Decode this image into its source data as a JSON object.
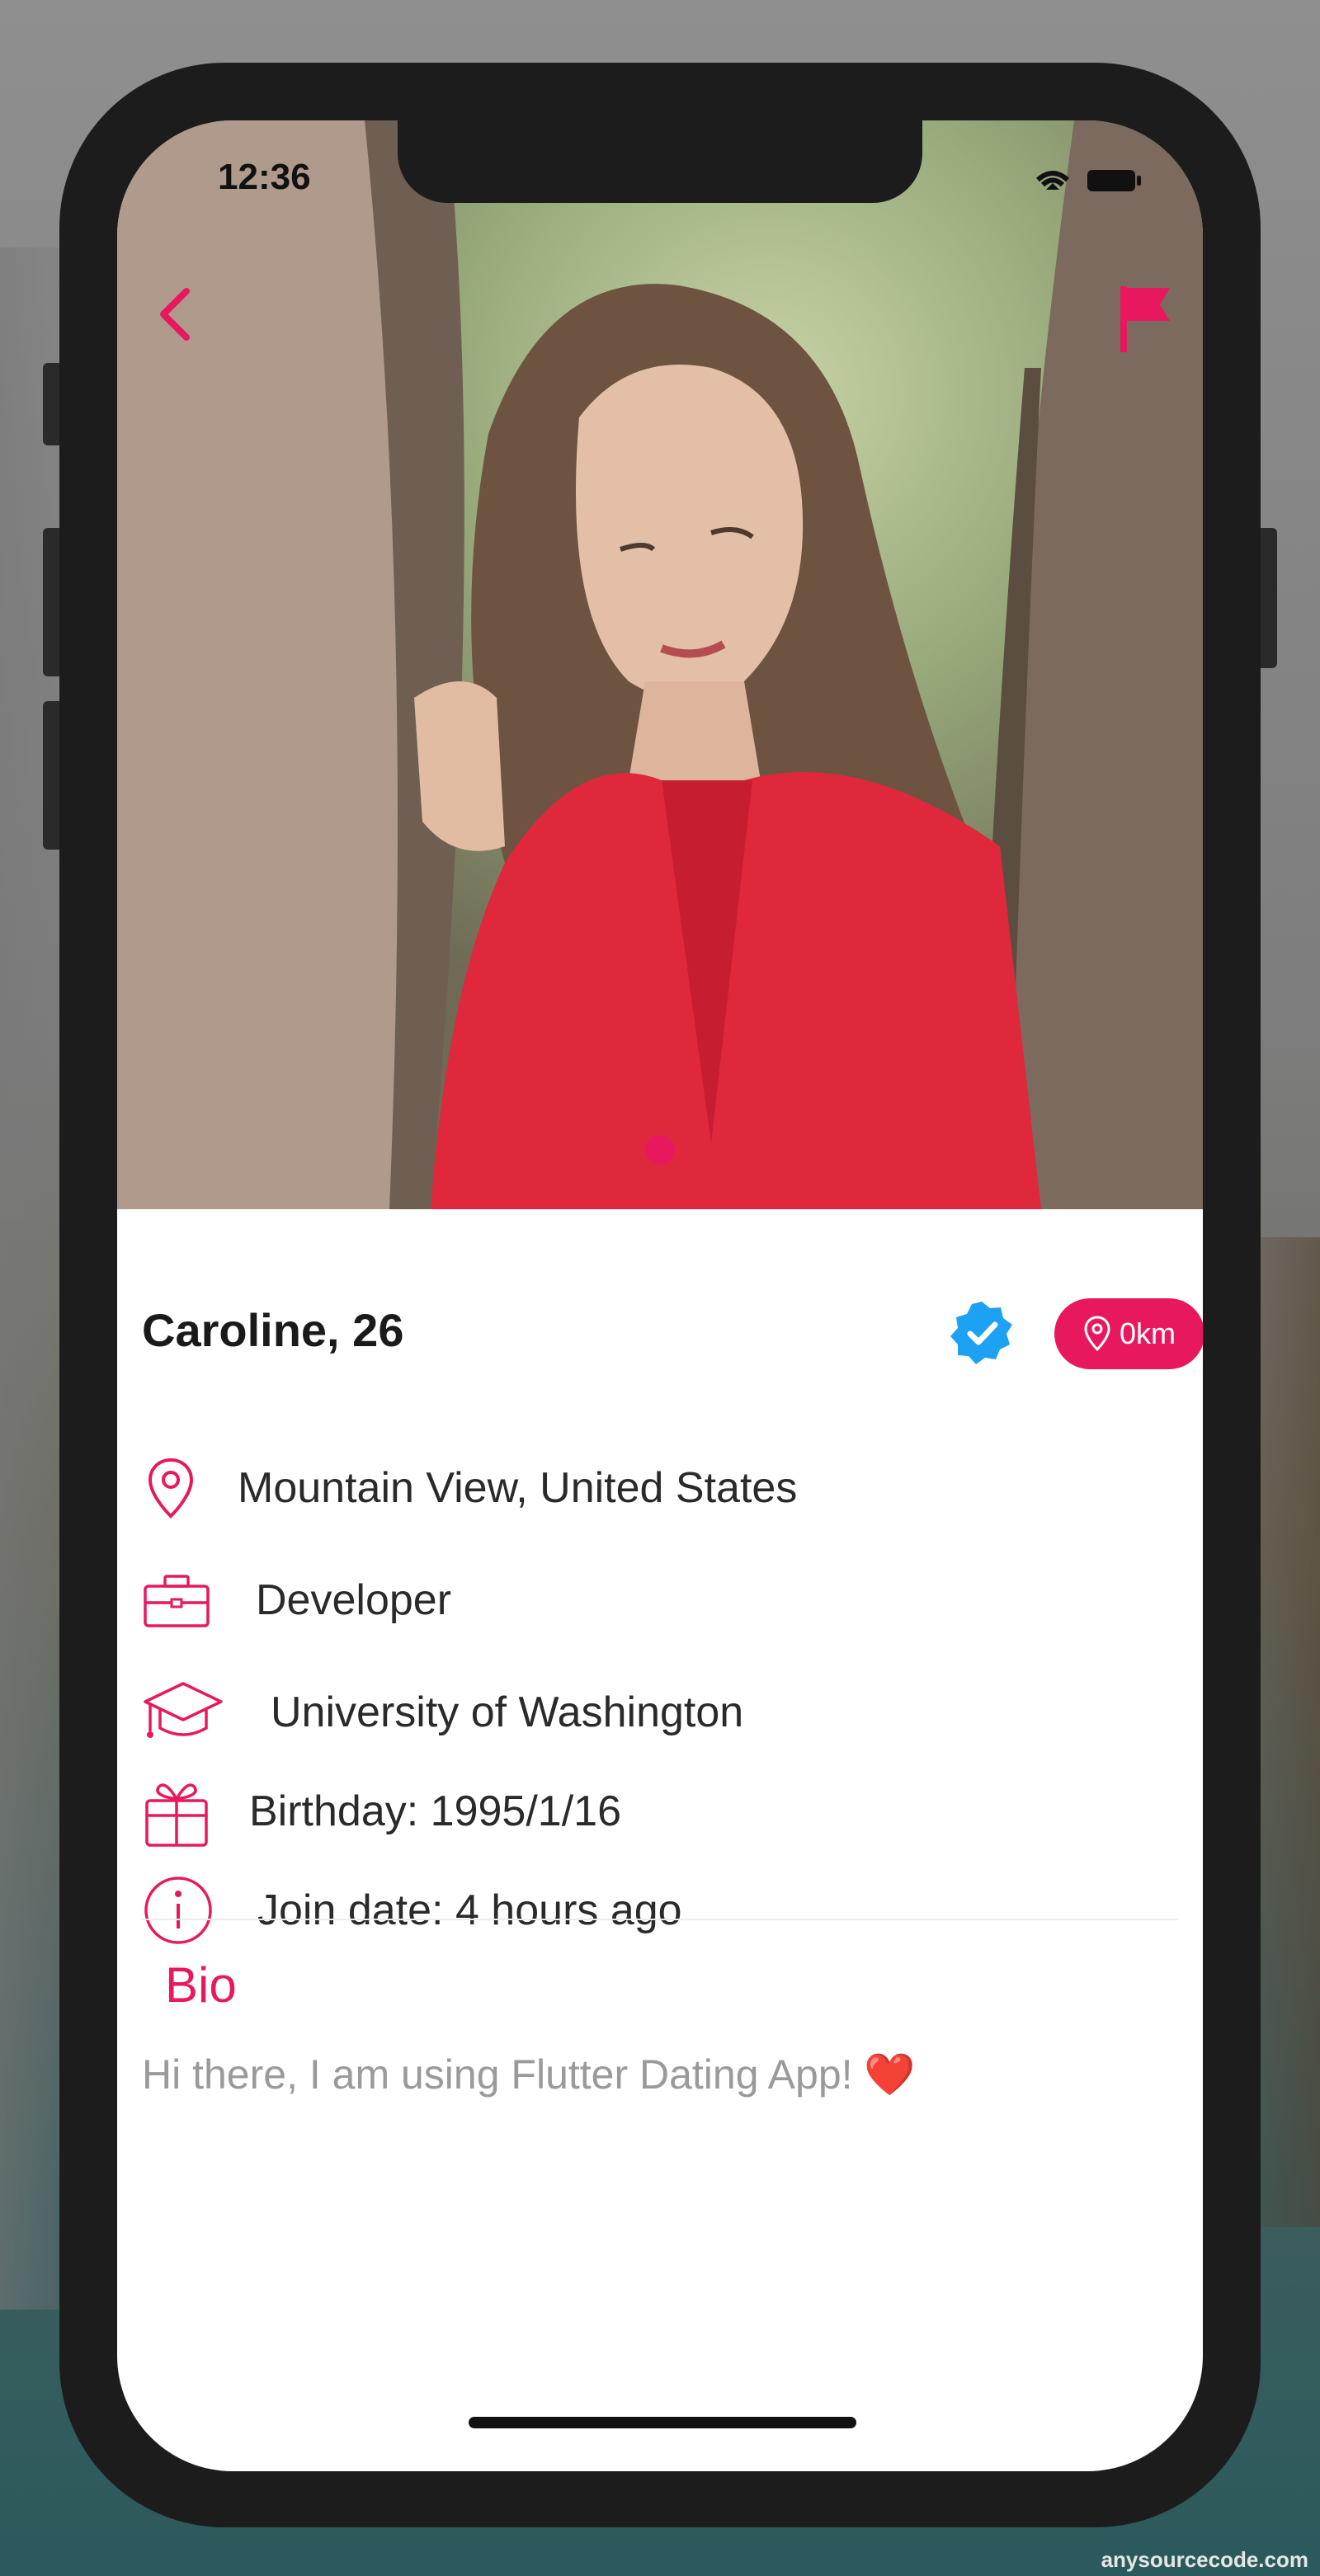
{
  "status_bar": {
    "time": "12:36"
  },
  "profile": {
    "name_age": "Caroline, 26",
    "distance": "0km",
    "location": "Mountain View, United States",
    "job": "Developer",
    "school": "University of Washington",
    "birthday": "Birthday: 1995/1/16",
    "join_date": "Join date: 4 hours ago"
  },
  "bio": {
    "title": "Bio",
    "text": "Hi there, I am using Flutter Dating App! ❤️"
  },
  "watermark": "anysourcecode.com",
  "colors": {
    "accent": "#e8185f",
    "verified": "#1da1f2",
    "text": "#2a2a2a",
    "muted": "#9a9a9a"
  },
  "icons": [
    "back-arrow-icon",
    "report-flag-icon",
    "verified-badge-icon",
    "location-pin-icon",
    "briefcase-icon",
    "graduation-cap-icon",
    "gift-icon",
    "info-icon",
    "wifi-icon",
    "battery-icon"
  ]
}
